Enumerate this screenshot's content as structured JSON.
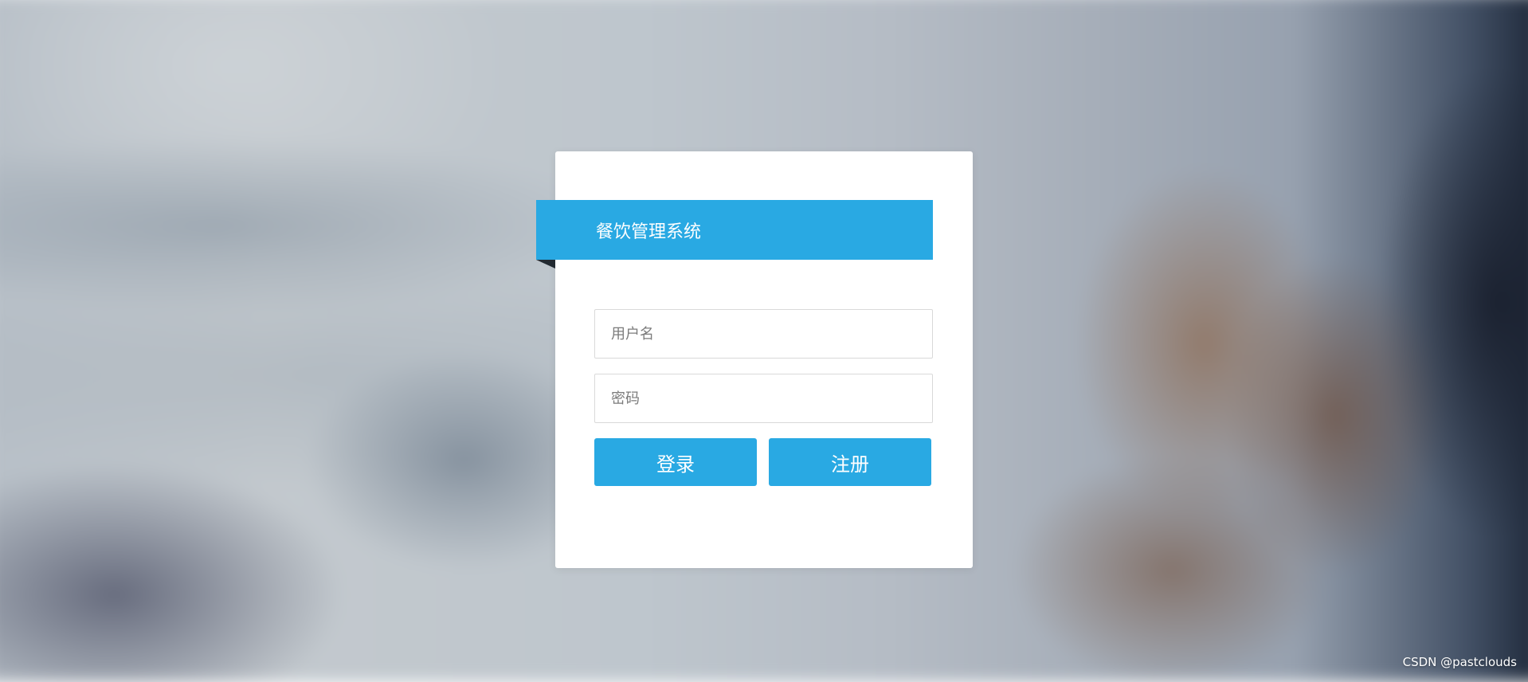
{
  "login": {
    "title": "餐饮管理系统",
    "username_placeholder": "用户名",
    "password_placeholder": "密码",
    "login_label": "登录",
    "register_label": "注册"
  },
  "watermark": "CSDN @pastclouds",
  "colors": {
    "accent": "#29a9e3",
    "card": "#ffffff"
  }
}
